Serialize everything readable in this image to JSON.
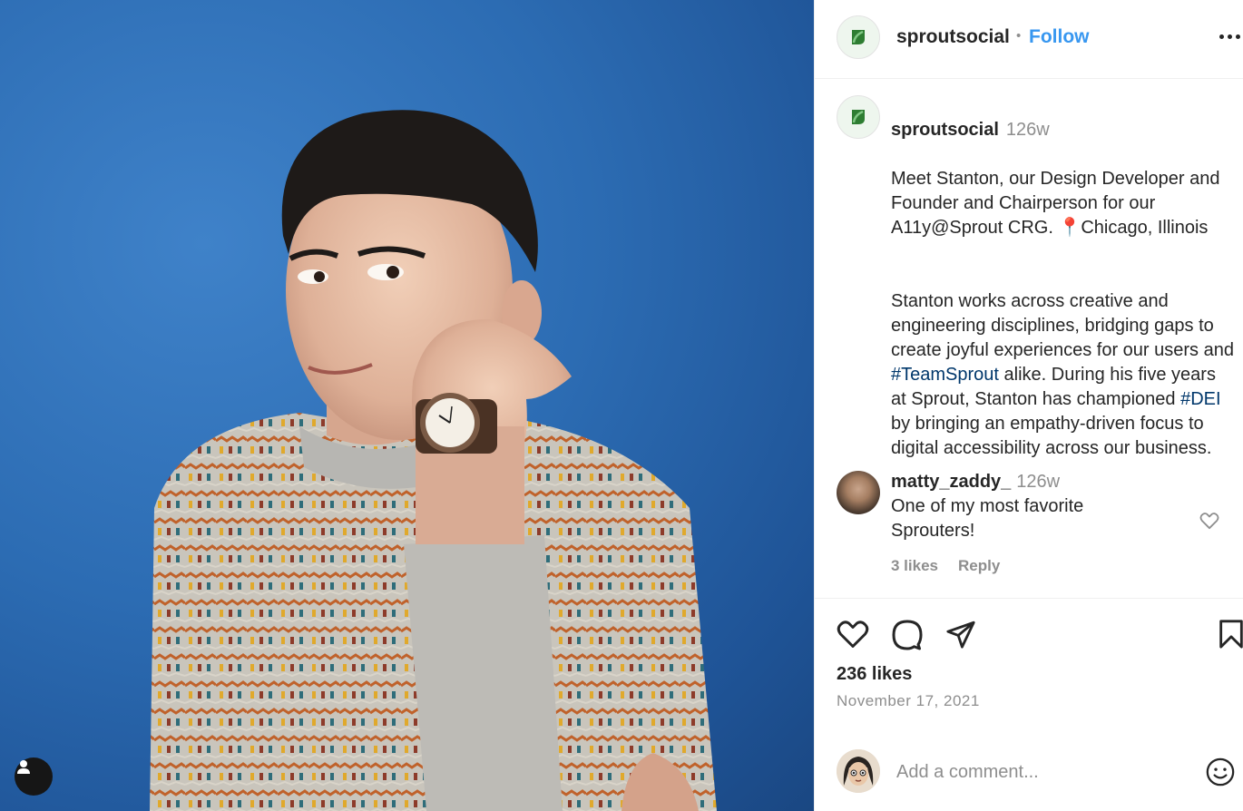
{
  "post": {
    "username": "sproutsocial",
    "follow_label": "Follow",
    "separator": "•"
  },
  "caption": {
    "username": "sproutsocial",
    "time": "126w",
    "line1": "Meet Stanton, our Design Developer and Founder and Chairperson for our A11y@Sprout CRG. ",
    "location_pin": "📍",
    "location": "Chicago, Illinois",
    "para2_a": "Stanton works across creative and engineering disciplines, bridging gaps to create joyful experiences for our users and ",
    "hashtag1": "#TeamSprout",
    "para2_b": " alike. During his five years at Sprout, Stanton has championed ",
    "hashtag2": "#DEI",
    "para2_c": " by bringing an empathy-driven focus to digital accessibility across our business."
  },
  "comment": {
    "username": "matty_zaddy_",
    "time": "126w",
    "text": "One of my most favorite Sprouters!",
    "likes": "3 likes",
    "reply": "Reply"
  },
  "stats": {
    "likes": "236 likes",
    "date": "November 17, 2021"
  },
  "add_comment": {
    "placeholder": "Add a comment..."
  },
  "icons": {
    "brand_logo": "sprout-leaf-icon",
    "more": "more-options-icon",
    "like": "heart-icon",
    "comment": "comment-bubble-icon",
    "share": "paper-plane-icon",
    "save": "bookmark-icon",
    "emoji": "smiley-icon",
    "tag_user": "user-tag-icon"
  },
  "colors": {
    "follow": "#3897f0",
    "hashtag": "#00376b",
    "brand_green": "#59cb59",
    "photo_background": "#2c6cb3"
  }
}
